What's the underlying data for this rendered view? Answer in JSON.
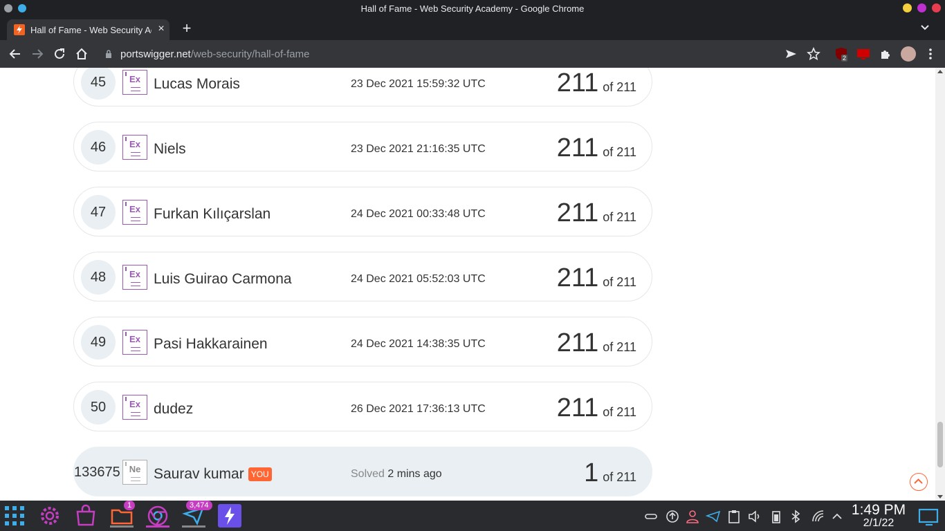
{
  "window": {
    "title": "Hall of Fame - Web Security Academy - Google Chrome"
  },
  "tab": {
    "title": "Hall of Fame - Web Security Academy",
    "close": "×"
  },
  "newtab": "+",
  "address": {
    "domain": "portswigger.net",
    "path": "/web-security/hall-of-fame"
  },
  "extensions": {
    "ublock_count": "2"
  },
  "rows": [
    {
      "rank": "45",
      "badge": "Ex",
      "name": "Lucas Morais",
      "date": "23 Dec 2021 15:59:32 UTC",
      "score": "211",
      "of": "of 211"
    },
    {
      "rank": "46",
      "badge": "Ex",
      "name": "Niels",
      "date": "23 Dec 2021 21:16:35 UTC",
      "score": "211",
      "of": "of 211"
    },
    {
      "rank": "47",
      "badge": "Ex",
      "name": "Furkan Kılıçarslan",
      "date": "24 Dec 2021 00:33:48 UTC",
      "score": "211",
      "of": "of 211"
    },
    {
      "rank": "48",
      "badge": "Ex",
      "name": "Luis Guirao Carmona",
      "date": "24 Dec 2021 05:52:03 UTC",
      "score": "211",
      "of": "of 211"
    },
    {
      "rank": "49",
      "badge": "Ex",
      "name": "Pasi Hakkarainen",
      "date": "24 Dec 2021 14:38:35 UTC",
      "score": "211",
      "of": "of 211"
    },
    {
      "rank": "50",
      "badge": "Ex",
      "name": "dudez",
      "date": "26 Dec 2021 17:36:13 UTC",
      "score": "211",
      "of": "of 211"
    }
  ],
  "you_row": {
    "rank": "133675",
    "badge": "Ne",
    "name": "Saurav kumar",
    "tag": "YOU",
    "solved_label": "Solved",
    "solved_when": "2 mins ago",
    "score": "1",
    "of": "of 211"
  },
  "taskbar": {
    "files_badge": "1",
    "app_badge": "3,474",
    "time": "1:49 PM",
    "date": "2/1/22"
  },
  "colors": {
    "accent": "#ff6633",
    "badge_expert": "#9b59b6",
    "row_highlight": "#e9eff2"
  }
}
